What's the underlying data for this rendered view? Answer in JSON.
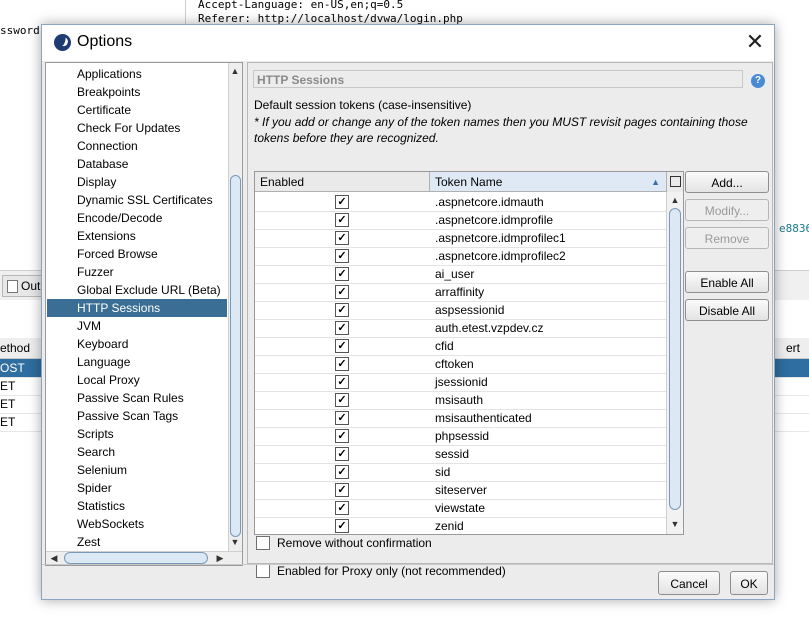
{
  "background": {
    "editor_lines": [
      "Accept-Language: en-US,en;q=0.5",
      "Referer: http://localhost/dvwa/login.php"
    ],
    "left_text": "ssword,c",
    "right_hex": "e8836",
    "tab_label": "Out",
    "col_method": "ethod",
    "col_right": "ert",
    "rows": [
      "OST",
      "ET",
      "ET",
      "ET"
    ]
  },
  "dialog": {
    "title": "Options",
    "close_symbol": "✕"
  },
  "tree": {
    "items": [
      "Applications",
      "Breakpoints",
      "Certificate",
      "Check For Updates",
      "Connection",
      "Database",
      "Display",
      "Dynamic SSL Certificates",
      "Encode/Decode",
      "Extensions",
      "Forced Browse",
      "Fuzzer",
      "Global Exclude URL (Beta)",
      "HTTP Sessions",
      "JVM",
      "Keyboard",
      "Language",
      "Local Proxy",
      "Passive Scan Rules",
      "Passive Scan Tags",
      "Scripts",
      "Search",
      "Selenium",
      "Spider",
      "Statistics",
      "WebSockets",
      "Zest"
    ],
    "selected": "HTTP Sessions"
  },
  "panel": {
    "header": "HTTP Sessions",
    "help_symbol": "?",
    "description": "Default session tokens (case-insensitive)",
    "note": "* If you add or change any of the token names then you MUST revisit pages containing those tokens before they are recognized.",
    "columns": {
      "enabled": "Enabled",
      "token_name": "Token Name"
    },
    "tokens": [
      ".aspnetcore.idmauth",
      ".aspnetcore.idmprofile",
      ".aspnetcore.idmprofilec1",
      ".aspnetcore.idmprofilec2",
      "ai_user",
      "arraffinity",
      "aspsessionid",
      "auth.etest.vzpdev.cz",
      "cfid",
      "cftoken",
      "jsessionid",
      "msisauth",
      "msisauthenticated",
      "phpsessid",
      "sessid",
      "sid",
      "siteserver",
      "viewstate",
      "zenid"
    ],
    "check_mark": "✓",
    "buttons": {
      "add": "Add...",
      "modify": "Modify...",
      "remove": "Remove",
      "enable_all": "Enable All",
      "disable_all": "Disable All"
    },
    "options": {
      "remove_without_confirmation": "Remove without confirmation",
      "enabled_for_proxy_only": "Enabled for Proxy only (not recommended)"
    }
  },
  "footer": {
    "cancel": "Cancel",
    "ok": "OK"
  }
}
